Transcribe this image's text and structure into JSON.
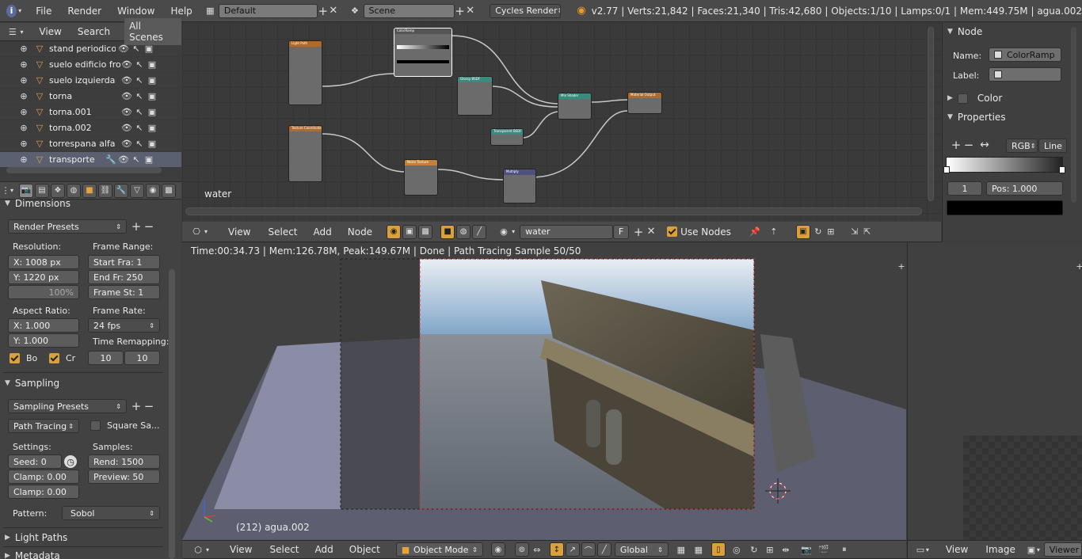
{
  "topbar": {
    "menus": [
      "File",
      "Render",
      "Window",
      "Help"
    ],
    "screen_layout": "Default",
    "scene": "Scene",
    "engine": "Cycles Render",
    "stats": "v2.77 | Verts:21,842 | Faces:21,340 | Tris:42,680 | Objects:1/10 | Lamps:0/1 | Mem:449.75M | agua.002"
  },
  "outliner": {
    "tabs": [
      "View",
      "Search",
      "All Scenes"
    ],
    "items": [
      {
        "name": "stand periodicos"
      },
      {
        "name": "suelo edificio front"
      },
      {
        "name": "suelo izquierda"
      },
      {
        "name": "torna"
      },
      {
        "name": "torna.001"
      },
      {
        "name": "torna.002"
      },
      {
        "name": "torrespana alfa"
      },
      {
        "name": "transporte"
      }
    ]
  },
  "properties": {
    "dimensions_header": "Dimensions",
    "render_presets": "Render Presets",
    "resolution_label": "Resolution:",
    "res_x": "X:  1008 px",
    "res_y": "Y:  1220 px",
    "res_pct": "100%",
    "frame_range_label": "Frame Range:",
    "start_frame": "Start Fra:    1",
    "end_frame": "End Fr:   250",
    "frame_step": "Frame St:    1",
    "aspect_label": "Aspect Ratio:",
    "aspect_x": "X:      1.000",
    "aspect_y": "Y:      1.000",
    "frame_rate_label": "Frame Rate:",
    "frame_rate": "24 fps",
    "time_remap_label": "Time Remapping:",
    "remap_old": "10",
    "remap_new": "10",
    "border_label": "Bo",
    "crop_label": "Cr",
    "sampling_header": "Sampling",
    "sampling_presets": "Sampling Presets",
    "integrator": "Path Tracing",
    "square_samples": "Square Sa...",
    "settings_label": "Settings:",
    "samples_label": "Samples:",
    "seed": "Seed:      0",
    "clamp1": "Clamp: 0.00",
    "clamp2": "Clamp: 0.00",
    "render_samples": "Rend:  1500",
    "preview_samples": "Preview:   50",
    "pattern_label": "Pattern:",
    "pattern": "Sobol",
    "light_paths_header": "Light Paths",
    "metadata_header": "Metadata"
  },
  "node_editor": {
    "material_label": "water",
    "menus": [
      "View",
      "Select",
      "Add",
      "Node"
    ],
    "material_name": "water",
    "fake_user": "F",
    "use_nodes": "Use Nodes",
    "nodes": {
      "light_path": "Light Path",
      "color_ramp": "ColorRamp",
      "glossy": "Glossy BSDF",
      "transparent": "Transparent BSDF",
      "mix": "Mix Shader",
      "output": "Material Output",
      "texcoord": "Texture Coordinate",
      "noise": "Noise Texture",
      "multiply": "Multiply"
    }
  },
  "node_panel": {
    "node_header": "Node",
    "name_label": "Name:",
    "name_value": "ColorRamp",
    "label_label": "Label:",
    "color_header": "Color",
    "properties_header": "Properties",
    "color_mode": "RGB",
    "interpolation": "Line",
    "stop_index": "1",
    "pos": "Pos:     1.000"
  },
  "viewport": {
    "render_info": "Time:00:34.73 | Mem:126.78M, Peak:149.67M | Done | Path Tracing Sample 50/50",
    "object_label": "(212) agua.002",
    "menus": [
      "View",
      "Select",
      "Add",
      "Object"
    ],
    "mode": "Object Mode",
    "orientation": "Global"
  },
  "image_editor": {
    "menus": [
      "View",
      "Image"
    ],
    "image_name": "Viewer N"
  },
  "colors": {
    "accent": "#d9a03b",
    "bg": "#3d3d3d",
    "header": "#4a4a4a"
  }
}
